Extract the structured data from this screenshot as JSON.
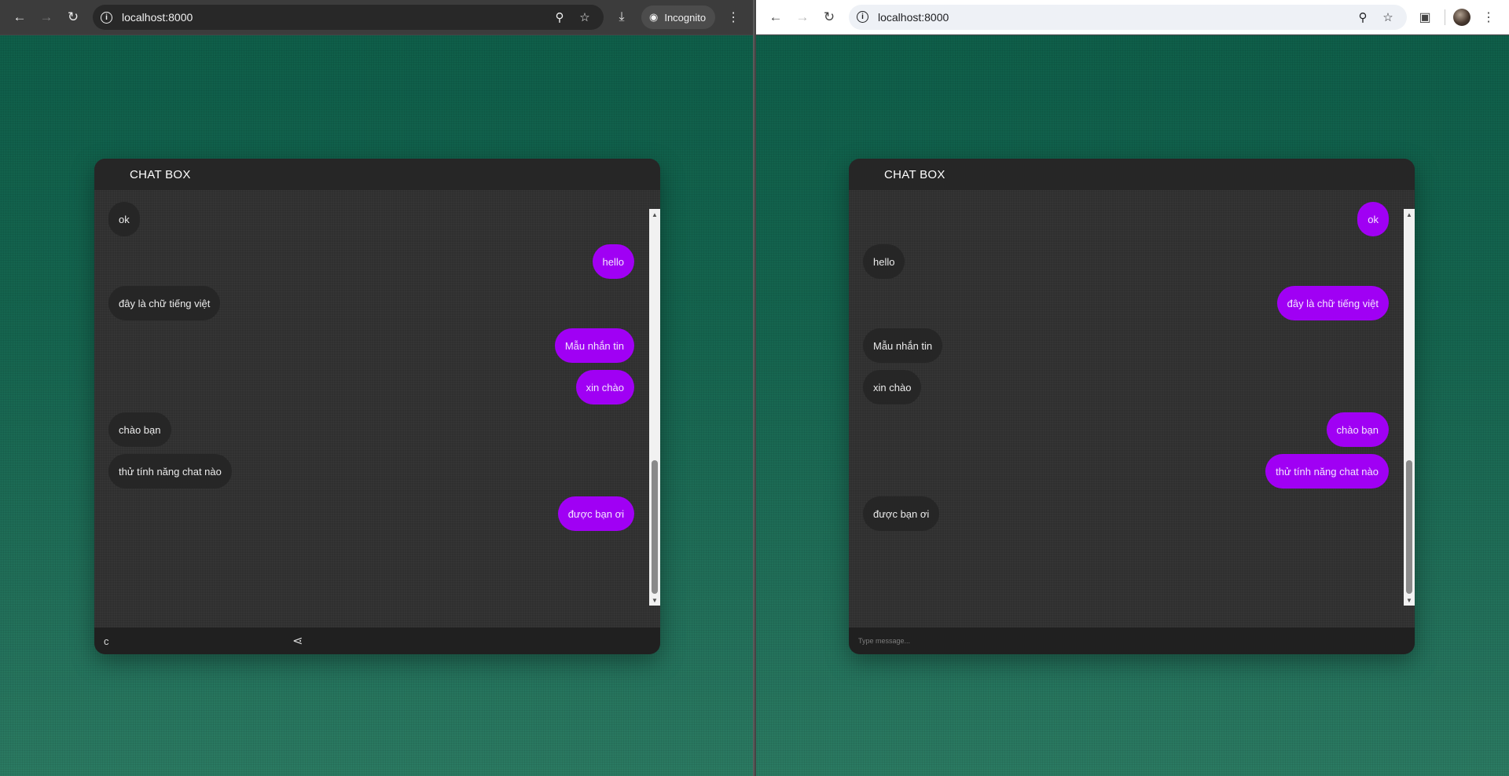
{
  "left_window": {
    "url": "localhost:8000",
    "incognito_label": "Incognito",
    "chat": {
      "title": "CHAT BOX",
      "messages": [
        {
          "text": "ok",
          "side": "left"
        },
        {
          "text": "hello",
          "side": "right"
        },
        {
          "text": "đây là chữ tiếng việt",
          "side": "left"
        },
        {
          "text": "Mẫu nhắn tin",
          "side": "right"
        },
        {
          "text": "xin chào",
          "side": "right"
        },
        {
          "text": "chào bạn",
          "side": "left"
        },
        {
          "text": "thử tính năng chat nào",
          "side": "left"
        },
        {
          "text": "được bạn ơi",
          "side": "right"
        }
      ],
      "input_value": "c",
      "input_placeholder": "Type message..."
    }
  },
  "right_window": {
    "url": "localhost:8000",
    "chat": {
      "title": "CHAT BOX",
      "messages": [
        {
          "text": "ok",
          "side": "right"
        },
        {
          "text": "hello",
          "side": "left"
        },
        {
          "text": "đây là chữ tiếng việt",
          "side": "right"
        },
        {
          "text": "Mẫu nhắn tin",
          "side": "left"
        },
        {
          "text": "xin chào",
          "side": "left"
        },
        {
          "text": "chào bạn",
          "side": "right"
        },
        {
          "text": "thử tính năng chat nào",
          "side": "right"
        },
        {
          "text": "được bạn ơi",
          "side": "left"
        }
      ],
      "input_value": "",
      "input_placeholder": "Type message..."
    }
  },
  "icons": {
    "back": "arrow-left-icon",
    "forward": "arrow-right-icon",
    "reload": "reload-icon",
    "site_info": "info-icon",
    "zoom": "zoom-icon",
    "bookmark": "star-icon",
    "download": "download-icon",
    "incognito": "incognito-icon",
    "menu": "kebab-menu-icon",
    "extensions": "puzzle-icon",
    "profile": "avatar"
  },
  "colors": {
    "sent_bubble": "#a000f4",
    "received_bubble": "#262626",
    "chat_background": "#2f2f2f",
    "page_background": "#15654f"
  }
}
